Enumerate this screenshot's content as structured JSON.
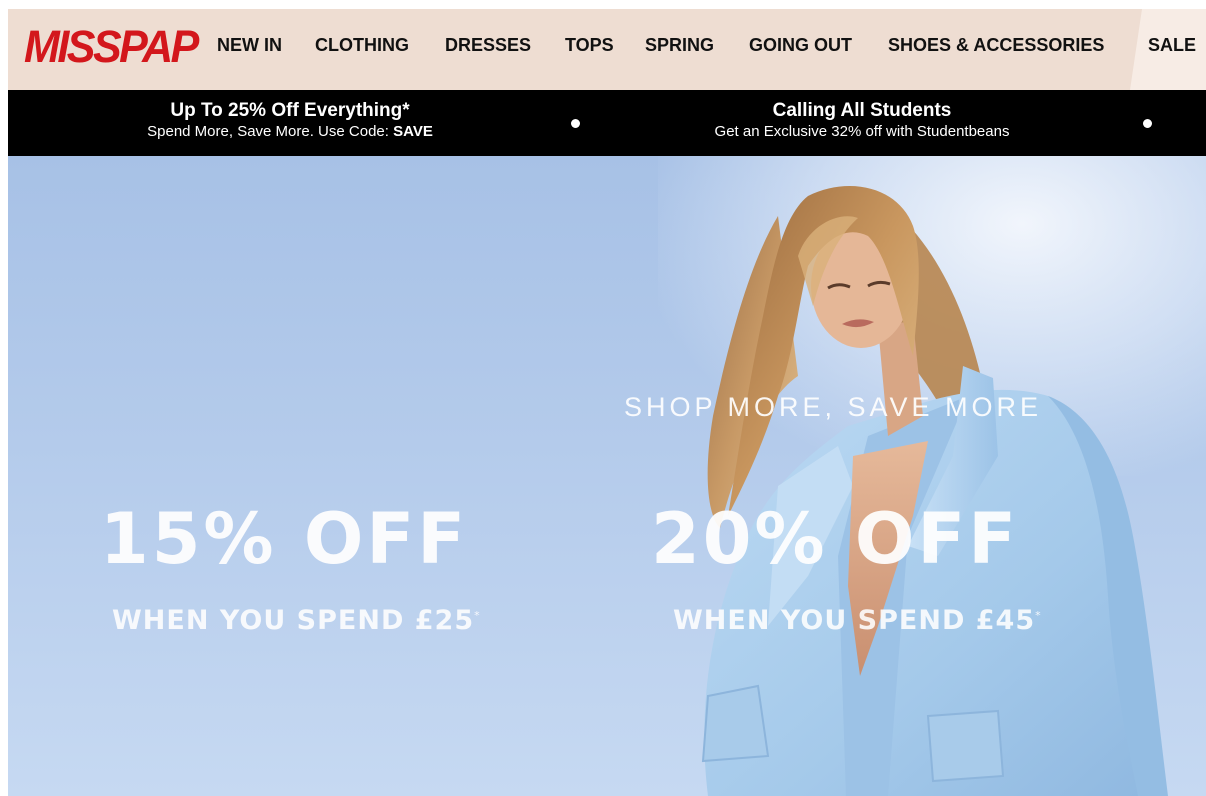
{
  "header": {
    "logo": "MISSPAP",
    "nav": [
      {
        "label": "NEW IN"
      },
      {
        "label": "CLOTHING"
      },
      {
        "label": "DRESSES"
      },
      {
        "label": "TOPS"
      },
      {
        "label": "SPRING"
      },
      {
        "label": "GOING OUT"
      },
      {
        "label": "SHOES & ACCESSORIES"
      },
      {
        "label": "SALE"
      }
    ]
  },
  "promo_bar": {
    "promos": [
      {
        "title": "Up To 25% Off Everything*",
        "subtitle_prefix": "Spend More, Save More. Use Code: ",
        "code": "SAVE"
      },
      {
        "title": "Calling All Students",
        "subtitle": "Get an Exclusive 32% off with Studentbeans"
      }
    ]
  },
  "hero": {
    "kicker": "SHOP MORE, SAVE MORE",
    "offers": [
      {
        "headline": "15% OFF",
        "condition": "WHEN YOU SPEND £25",
        "mark": "*"
      },
      {
        "headline": "20% OFF",
        "condition": "WHEN YOU SPEND £45",
        "mark": "*"
      }
    ]
  },
  "colors": {
    "logo_red": "#d3171c",
    "header_bg": "#eeddd2",
    "promo_bg": "#000000",
    "hero_sky": "#b4cbeb",
    "blazer": "#a9cdec"
  }
}
